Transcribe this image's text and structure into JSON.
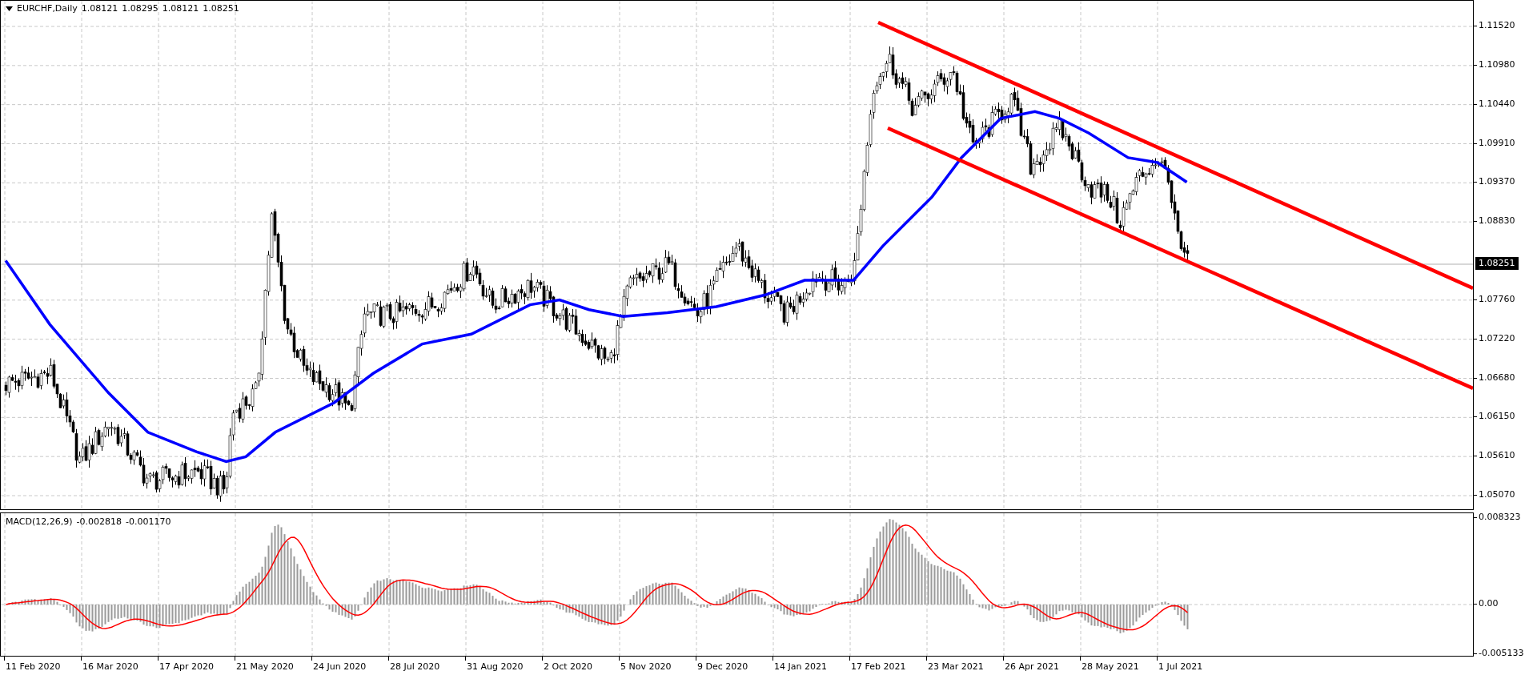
{
  "chart": {
    "symbol": "EURCHF,Daily",
    "ohlc": [
      "1.08121",
      "1.08295",
      "1.08121",
      "1.08251"
    ],
    "price_axis": [
      "1.11520",
      "1.10980",
      "1.10440",
      "1.09910",
      "1.09370",
      "1.08830",
      "1.07760",
      "1.07220",
      "1.06680",
      "1.06150",
      "1.05610",
      "1.05070"
    ],
    "current_price": "1.08251",
    "time_axis": [
      "11 Feb 2020",
      "16 Mar 2020",
      "17 Apr 2020",
      "21 May 2020",
      "24 Jun 2020",
      "28 Jul 2020",
      "31 Aug 2020",
      "2 Oct 2020",
      "5 Nov 2020",
      "9 Dec 2020",
      "14 Jan 2021",
      "17 Feb 2021",
      "23 Mar 2021",
      "26 Apr 2021",
      "28 May 2021",
      "1 Jul 2021"
    ]
  },
  "macd": {
    "name": "MACD(12,26,9)",
    "values": [
      "-0.002818",
      "-0.001170"
    ],
    "axis": [
      "0.008323",
      "0.00",
      "-0.005133"
    ]
  }
}
